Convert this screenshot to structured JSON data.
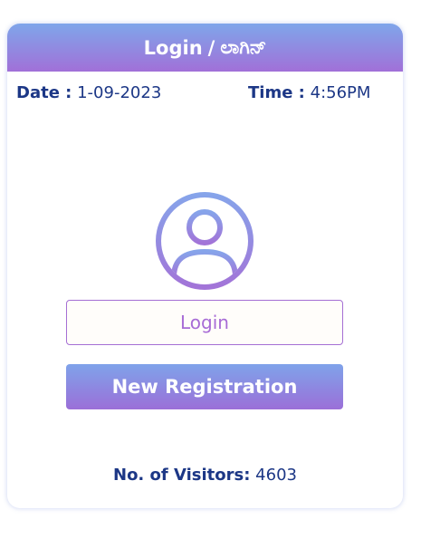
{
  "header": {
    "title_en": "Login",
    "separator": "/",
    "title_kn": "ಲಾಗಿನ್"
  },
  "info": {
    "date_label": "Date :",
    "date_value": "1-09-2023",
    "time_label": "Time :",
    "time_value": "4:56PM"
  },
  "avatar_icon": "user-circle-icon",
  "buttons": {
    "login_label": "Login",
    "register_label": "New Registration"
  },
  "visitors": {
    "label": "No. of Visitors:",
    "count": "4603"
  },
  "colors": {
    "gradient_start": "#7fa6ea",
    "gradient_end": "#a170d8",
    "text_dark_blue": "#1c3786",
    "login_border": "#a56fd4"
  }
}
